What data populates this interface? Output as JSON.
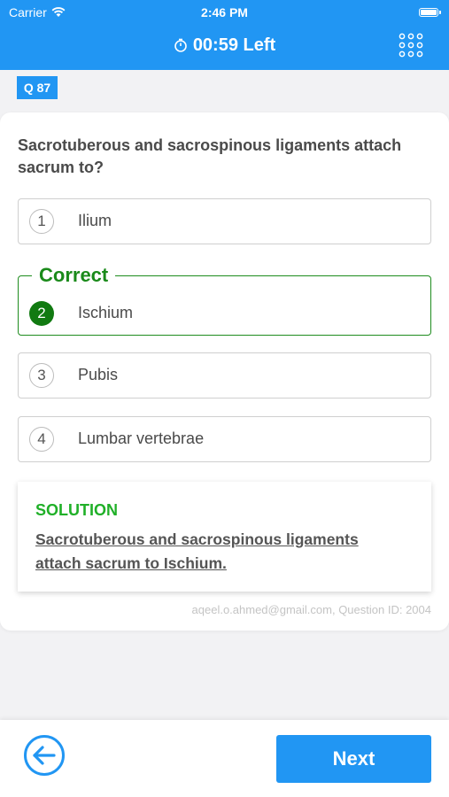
{
  "status_bar": {
    "carrier": "Carrier",
    "time": "2:46 PM"
  },
  "header": {
    "timer": "00:59 Left",
    "timer_icon": "stopwatch-icon",
    "menu_icon": "grid-icon"
  },
  "question": {
    "badge": "Q 87",
    "text": "Sacrotuberous and sacrospinous ligaments attach sacrum to?",
    "options": [
      {
        "num": "1",
        "label": "Ilium"
      },
      {
        "num": "2",
        "label": "Ischium",
        "state": "Correct"
      },
      {
        "num": "3",
        "label": "Pubis"
      },
      {
        "num": "4",
        "label": "Lumbar vertebrae"
      }
    ]
  },
  "solution": {
    "title": "SOLUTION",
    "text": "Sacrotuberous and sacrospinous ligaments attach sacrum to Ischium."
  },
  "footer_note": "aqeel.o.ahmed@gmail.com, Question ID: 2004",
  "nav": {
    "next_label": "Next",
    "back_icon": "back-arrow-icon"
  },
  "colors": {
    "accent": "#2196f3",
    "correct": "#1a8a1a",
    "solution": "#20b028"
  }
}
